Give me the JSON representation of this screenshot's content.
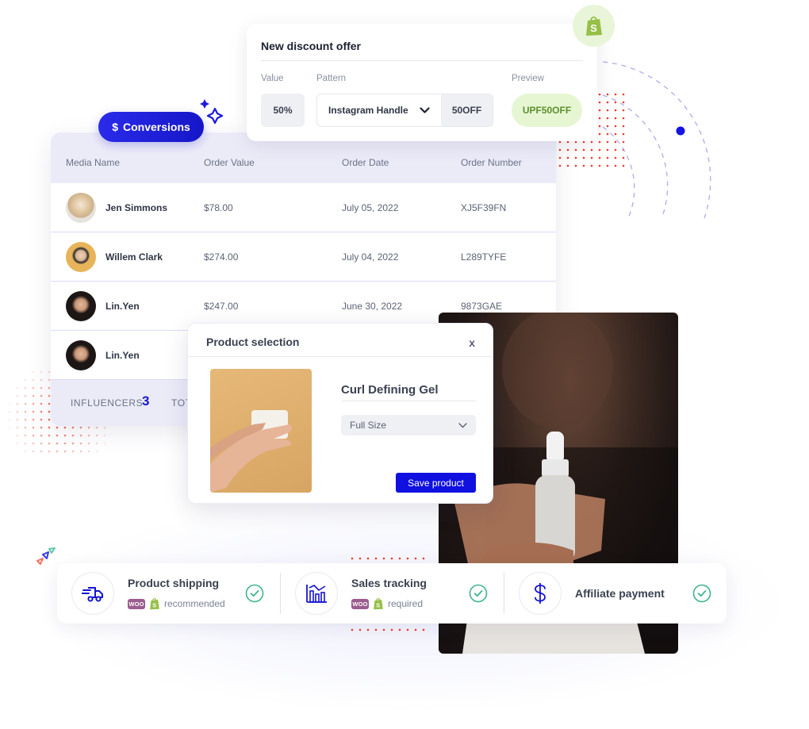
{
  "discount_offer": {
    "title": "New discount offer",
    "labels": {
      "value": "Value",
      "pattern": "Pattern",
      "preview": "Preview"
    },
    "value": "50%",
    "pattern_selected": "Instagram Handle",
    "pattern_suffix": "50OFF",
    "preview_code": "UPF50OFF"
  },
  "badges": {
    "conversions_label": "Conversions",
    "conversions_symbol": "$"
  },
  "conversions_table": {
    "columns": [
      "Media Name",
      "Order Value",
      "Order Date",
      "Order Number"
    ],
    "rows": [
      {
        "name": "Jen Simmons",
        "value": "$78.00",
        "date": "July 05, 2022",
        "number": "XJ5F39FN"
      },
      {
        "name": "Willem Clark",
        "value": "$274.00",
        "date": "July 04, 2022",
        "number": "L289TYFE"
      },
      {
        "name": "Lin.Yen",
        "value": "$247.00",
        "date": "June 30, 2022",
        "number": "9873GAE"
      },
      {
        "name": "Lin.Yen",
        "value": "",
        "date": "",
        "number": ""
      }
    ],
    "footer": {
      "influencers_label": "INFLUENCERS",
      "influencers_count": "3",
      "total_label": "TOT"
    }
  },
  "product_selection": {
    "title": "Product selection",
    "close": "x",
    "product_name": "Curl Defining Gel",
    "size_selected": "Full Size",
    "save_label": "Save product"
  },
  "features": [
    {
      "icon": "delivery-truck-icon",
      "title": "Product shipping",
      "note": "recommended",
      "platforms": [
        "WooCommerce",
        "Shopify"
      ],
      "woo_text": "WOO"
    },
    {
      "icon": "chart-icon",
      "title": "Sales tracking",
      "note": "required",
      "platforms": [
        "WooCommerce",
        "Shopify"
      ],
      "woo_text": "WOO"
    },
    {
      "icon": "dollar-icon",
      "title": "Affiliate payment",
      "note": "",
      "platforms": []
    }
  ],
  "colors": {
    "accent_blue": "#1515d6",
    "preview_green": "#5d8f2e",
    "check_green": "#3fb68a",
    "shopify_green": "#95bf47",
    "woo_purple": "#9b5c8f"
  }
}
